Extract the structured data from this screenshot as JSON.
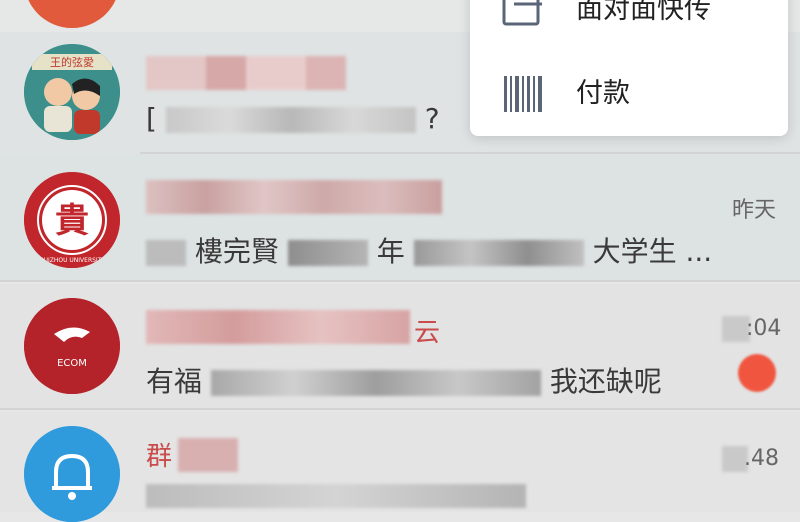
{
  "menu": {
    "items": [
      {
        "label": "面对面快传",
        "icon": "transfer-icon"
      },
      {
        "label": "付款",
        "icon": "barcode-icon"
      }
    ]
  },
  "chats": [
    {
      "preview_visible": "[",
      "preview_end": "?",
      "avatar_text": "王的弦愛"
    },
    {
      "time": "昨天",
      "preview_visible_1": "樓完賢",
      "preview_visible_2": "年",
      "preview_visible_3": "大学生",
      "preview_end": "...",
      "avatar_text": "貴",
      "avatar_ring_text": "GUIZHOU UNIVERSITY"
    },
    {
      "name_visible": "云",
      "time": ":04",
      "preview_start": "有福",
      "preview_visible": "我还缺呢",
      "avatar_text": "ECOM"
    },
    {
      "name_visible": "群",
      "time": ".48",
      "avatar_icon": "bell-icon"
    }
  ]
}
